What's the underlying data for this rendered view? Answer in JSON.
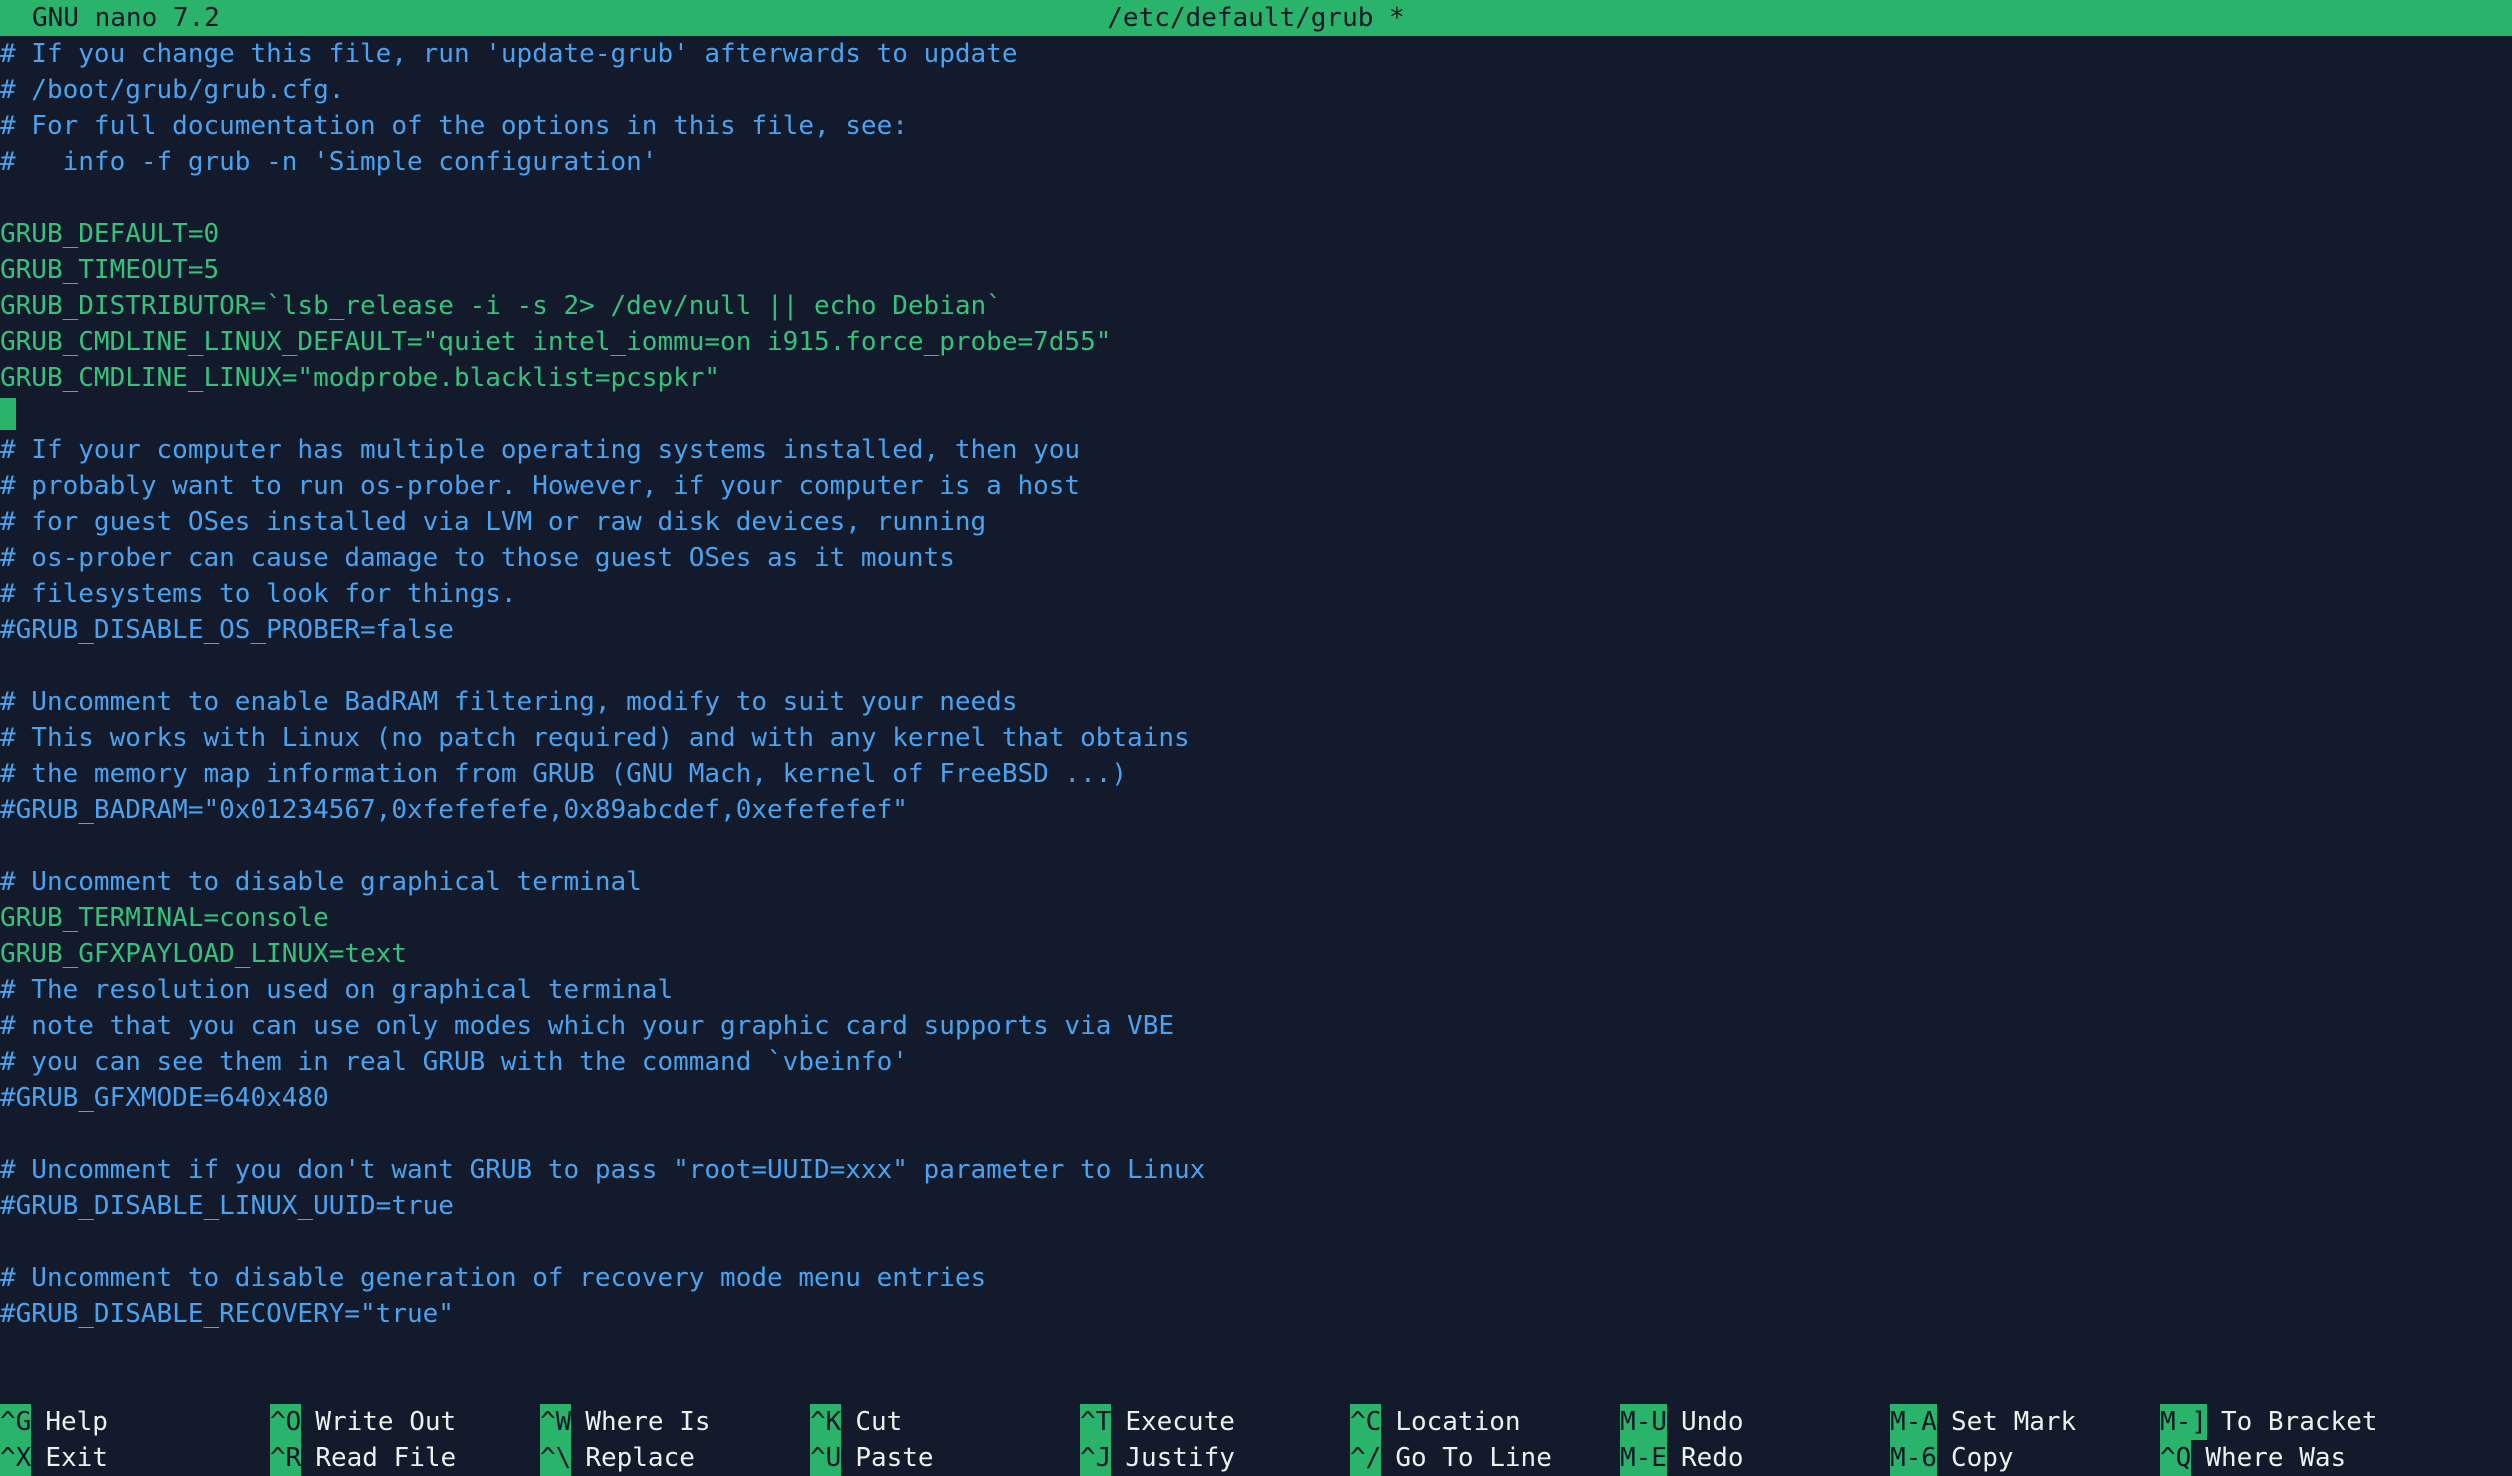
{
  "title": {
    "app": "GNU nano 7.2",
    "file": "/etc/default/grub *"
  },
  "lines": [
    {
      "t": "# If you change this file, run 'update-grub' afterwards to update",
      "k": "comment"
    },
    {
      "t": "# /boot/grub/grub.cfg.",
      "k": "comment"
    },
    {
      "t": "# For full documentation of the options in this file, see:",
      "k": "comment"
    },
    {
      "t": "#   info -f grub -n 'Simple configuration'",
      "k": "comment"
    },
    {
      "t": "",
      "k": "code"
    },
    {
      "t": "GRUB_DEFAULT=0",
      "k": "code"
    },
    {
      "t": "GRUB_TIMEOUT=5",
      "k": "code"
    },
    {
      "t": "GRUB_DISTRIBUTOR=`lsb_release -i -s 2> /dev/null || echo Debian`",
      "k": "code"
    },
    {
      "t": "GRUB_CMDLINE_LINUX_DEFAULT=\"quiet intel_iommu=on i915.force_probe=7d55\"",
      "k": "code"
    },
    {
      "t": "GRUB_CMDLINE_LINUX=\"modprobe.blacklist=pcspkr\"",
      "k": "code"
    },
    {
      "t": "",
      "k": "cursor"
    },
    {
      "t": "# If your computer has multiple operating systems installed, then you",
      "k": "comment"
    },
    {
      "t": "# probably want to run os-prober. However, if your computer is a host",
      "k": "comment"
    },
    {
      "t": "# for guest OSes installed via LVM or raw disk devices, running",
      "k": "comment"
    },
    {
      "t": "# os-prober can cause damage to those guest OSes as it mounts",
      "k": "comment"
    },
    {
      "t": "# filesystems to look for things.",
      "k": "comment"
    },
    {
      "t": "#GRUB_DISABLE_OS_PROBER=false",
      "k": "comment"
    },
    {
      "t": "",
      "k": "code"
    },
    {
      "t": "# Uncomment to enable BadRAM filtering, modify to suit your needs",
      "k": "comment"
    },
    {
      "t": "# This works with Linux (no patch required) and with any kernel that obtains",
      "k": "comment"
    },
    {
      "t": "# the memory map information from GRUB (GNU Mach, kernel of FreeBSD ...)",
      "k": "comment"
    },
    {
      "t": "#GRUB_BADRAM=\"0x01234567,0xfefefefe,0x89abcdef,0xefefefef\"",
      "k": "comment"
    },
    {
      "t": "",
      "k": "code"
    },
    {
      "t": "# Uncomment to disable graphical terminal",
      "k": "comment"
    },
    {
      "t": "GRUB_TERMINAL=console",
      "k": "code"
    },
    {
      "t": "GRUB_GFXPAYLOAD_LINUX=text",
      "k": "code"
    },
    {
      "t": "# The resolution used on graphical terminal",
      "k": "comment"
    },
    {
      "t": "# note that you can use only modes which your graphic card supports via VBE",
      "k": "comment"
    },
    {
      "t": "# you can see them in real GRUB with the command `vbeinfo'",
      "k": "comment"
    },
    {
      "t": "#GRUB_GFXMODE=640x480",
      "k": "comment"
    },
    {
      "t": "",
      "k": "code"
    },
    {
      "t": "# Uncomment if you don't want GRUB to pass \"root=UUID=xxx\" parameter to Linux",
      "k": "comment"
    },
    {
      "t": "#GRUB_DISABLE_LINUX_UUID=true",
      "k": "comment"
    },
    {
      "t": "",
      "k": "code"
    },
    {
      "t": "# Uncomment to disable generation of recovery mode menu entries",
      "k": "comment"
    },
    {
      "t": "#GRUB_DISABLE_RECOVERY=\"true\"",
      "k": "comment"
    }
  ],
  "shortcuts": [
    [
      {
        "key": "^G",
        "label": "Help"
      },
      {
        "key": "^X",
        "label": "Exit"
      }
    ],
    [
      {
        "key": "^O",
        "label": "Write Out"
      },
      {
        "key": "^R",
        "label": "Read File"
      }
    ],
    [
      {
        "key": "^W",
        "label": "Where Is"
      },
      {
        "key": "^\\",
        "label": "Replace"
      }
    ],
    [
      {
        "key": "^K",
        "label": "Cut"
      },
      {
        "key": "^U",
        "label": "Paste"
      }
    ],
    [
      {
        "key": "^T",
        "label": "Execute"
      },
      {
        "key": "^J",
        "label": "Justify"
      }
    ],
    [
      {
        "key": "^C",
        "label": "Location"
      },
      {
        "key": "^/",
        "label": "Go To Line"
      }
    ],
    [
      {
        "key": "M-U",
        "label": "Undo"
      },
      {
        "key": "M-E",
        "label": "Redo"
      }
    ],
    [
      {
        "key": "M-A",
        "label": "Set Mark"
      },
      {
        "key": "M-6",
        "label": "Copy"
      }
    ],
    [
      {
        "key": "M-]",
        "label": "To Bracket"
      },
      {
        "key": "^Q",
        "label": "Where Was"
      }
    ]
  ],
  "colors": {
    "background": "#131a2b",
    "accent": "#2ab36b",
    "comment": "#4aa3f0",
    "code": "#35c27b"
  }
}
